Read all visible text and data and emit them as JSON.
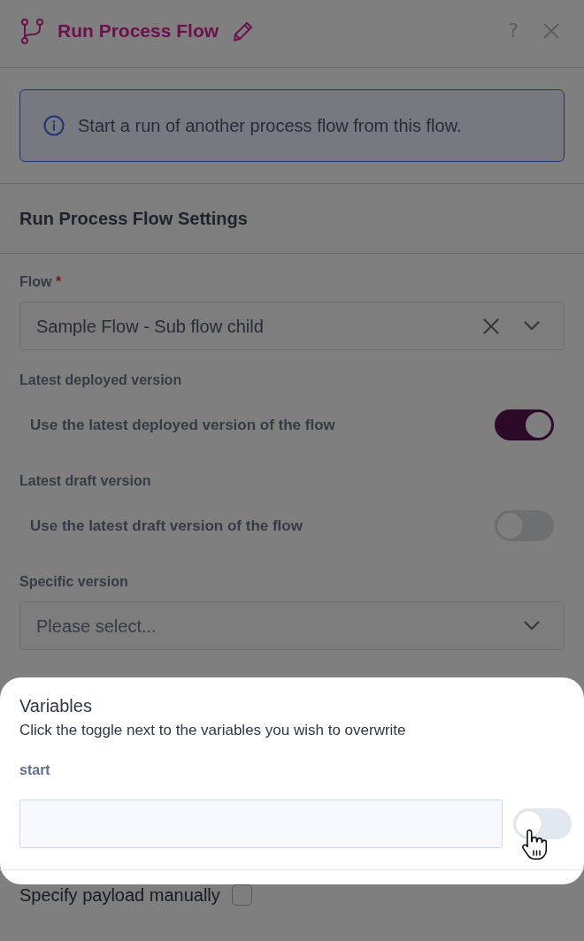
{
  "header": {
    "title": "Run Process Flow",
    "help": "?"
  },
  "info": {
    "text": "Start a run of another process flow from this flow."
  },
  "section": {
    "title": "Run Process Flow Settings"
  },
  "fields": [
    {
      "kind": "select",
      "label": "Flow",
      "required_mark": "*",
      "value": "Sample Flow - Sub flow child"
    },
    {
      "kind": "toggle",
      "label": "Latest deployed version",
      "text": "Use the latest deployed version of the flow",
      "on": true
    },
    {
      "kind": "toggle",
      "label": "Latest draft version",
      "text": "Use the latest draft version of the flow",
      "on": false
    },
    {
      "kind": "select",
      "label": "Specific version",
      "placeholder": "Please select..."
    }
  ],
  "variables": {
    "highlighted": true,
    "title": "Variables",
    "description": "Click the toggle next to the variables you wish to overwrite",
    "items": [
      {
        "name": "start",
        "on": false,
        "hovered": true
      }
    ]
  },
  "payload": {
    "label": "Specify payload manually",
    "checked": false
  }
}
